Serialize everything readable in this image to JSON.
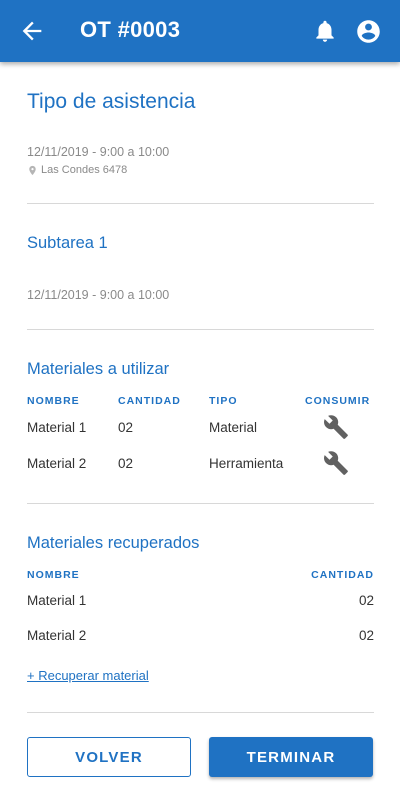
{
  "header": {
    "title": "OT #0003",
    "background_color": "#1f72c3",
    "icons": {
      "back": "arrow-back-icon",
      "notifications": "bell-icon",
      "account": "account-circle-icon"
    }
  },
  "task": {
    "title": "Tipo de asistencia",
    "datetime": "12/11/2019 - 9:00 a 10:00",
    "address": "Las Condes 6478"
  },
  "subtask": {
    "title": "Subtarea 1",
    "datetime": "12/11/2019 - 9:00 a 10:00"
  },
  "materials_to_use": {
    "title": "Materiales a utilizar",
    "columns": [
      "NOMBRE",
      "CANTIDAD",
      "TIPO",
      "CONSUMIR"
    ],
    "rows": [
      {
        "name": "Material 1",
        "quantity": "02",
        "type": "Material",
        "action_icon": "wrench-icon"
      },
      {
        "name": "Material 2",
        "quantity": "02",
        "type": "Herramienta",
        "action_icon": "wrench-icon"
      }
    ]
  },
  "recovered_materials": {
    "title": "Materiales recuperados",
    "columns": [
      "NOMBRE",
      "CANTIDAD"
    ],
    "rows": [
      {
        "name": "Material 1",
        "quantity": "02"
      },
      {
        "name": "Material 2",
        "quantity": "02"
      }
    ],
    "add_link": "+ Recuperar material"
  },
  "actions": {
    "back_label": "VOLVER",
    "finish_label": "TERMINAR"
  },
  "colors": {
    "accent": "#1f72c3",
    "muted_text": "#8a8a8a",
    "divider": "#d8d8d8"
  }
}
